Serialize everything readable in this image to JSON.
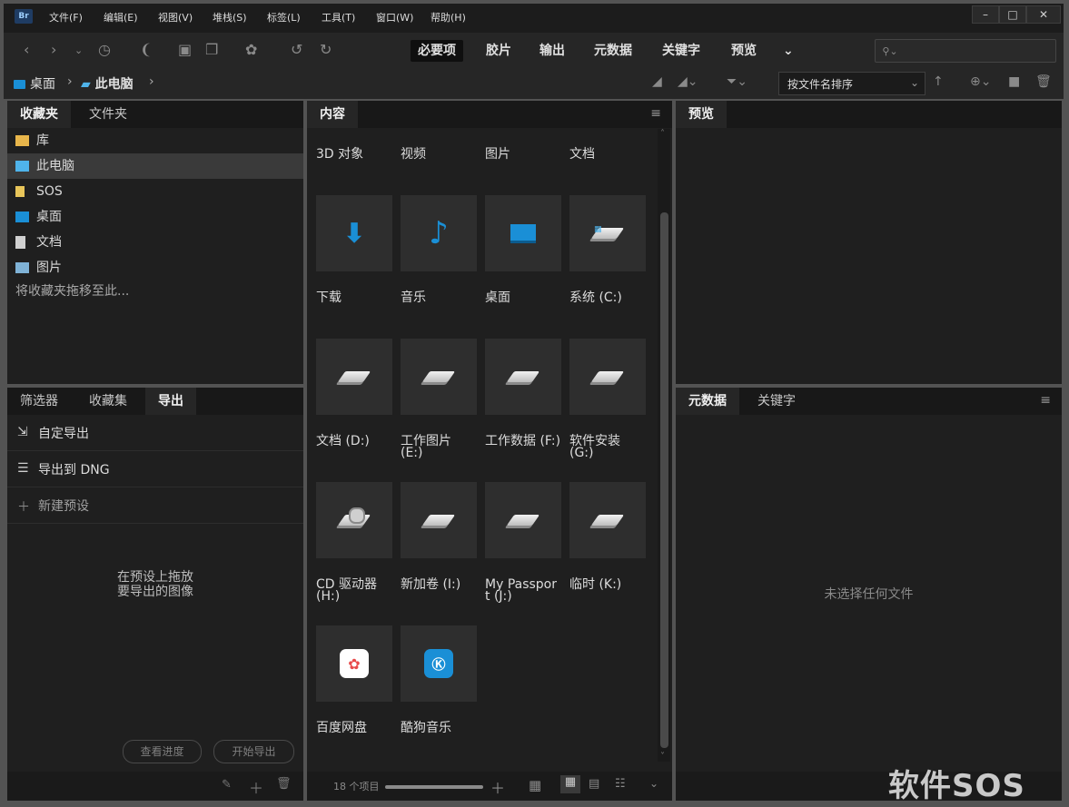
{
  "app": {
    "icon_label": "Br",
    "menus": [
      "文件(F)",
      "编辑(E)",
      "视图(V)",
      "堆栈(S)",
      "标签(L)",
      "工具(T)",
      "窗口(W)",
      "帮助(H)"
    ],
    "window_buttons": [
      "–",
      "□",
      "✕"
    ]
  },
  "toolbar": {
    "workspaces": [
      "必要项",
      "胶片",
      "输出",
      "元数据",
      "关键字",
      "预览"
    ],
    "active_workspace": "必要项",
    "more_glyph": "⌄",
    "search_placeholder": ""
  },
  "path": {
    "crumbs": [
      "桌面",
      "此电脑"
    ],
    "sort_label": "按文件名排序"
  },
  "favorites": {
    "tabs": [
      "收藏夹",
      "文件夹"
    ],
    "active_tab": "收藏夹",
    "items": [
      {
        "label": "库",
        "icon": "library-icon",
        "color": "#e8b64b"
      },
      {
        "label": "此电脑",
        "icon": "computer-icon",
        "color": "#4fb3ea"
      },
      {
        "label": "SOS",
        "icon": "folder-icon",
        "color": "#e8c55a"
      },
      {
        "label": "桌面",
        "icon": "desktop-icon",
        "color": "#1a8fd6"
      },
      {
        "label": "文档",
        "icon": "document-icon",
        "color": "#d0d0d0"
      },
      {
        "label": "图片",
        "icon": "picture-icon",
        "color": "#7fb2d6"
      }
    ],
    "selected_index": 1,
    "hint": "将收藏夹拖移至此..."
  },
  "export": {
    "tabs": [
      "筛选器",
      "收藏集",
      "导出"
    ],
    "active_tab": "导出",
    "rows": [
      {
        "label": "自定导出",
        "icon": "custom-export-icon"
      },
      {
        "label": "导出到 DNG",
        "icon": "list-icon"
      },
      {
        "label": "新建预设",
        "icon": "plus-icon"
      }
    ],
    "drop_hint_line1": "在预设上拖放",
    "drop_hint_line2": "要导出的图像",
    "progress_button": "查看进度",
    "start_button": "开始导出"
  },
  "content": {
    "tab": "内容",
    "top_labels": [
      "3D 对象",
      "视频",
      "图片",
      "文档"
    ],
    "items": [
      {
        "label": "下载",
        "icon": "download-arrow-icon"
      },
      {
        "label": "音乐",
        "icon": "music-note-icon"
      },
      {
        "label": "桌面",
        "icon": "desktop-icon"
      },
      {
        "label": "系统 (C:)",
        "icon": "windows-drive-icon"
      },
      {
        "label": "文档 (D:)",
        "icon": "drive-icon"
      },
      {
        "label": "工作图片 (E:)",
        "icon": "drive-icon"
      },
      {
        "label": "工作数据 (F:)",
        "icon": "drive-icon"
      },
      {
        "label": "软件安装 (G:)",
        "icon": "drive-icon"
      },
      {
        "label": "CD 驱动器 (H:)",
        "icon": "cd-drive-icon"
      },
      {
        "label": "新加卷 (I:)",
        "icon": "drive-icon"
      },
      {
        "label": "My Passport (J:)",
        "icon": "drive-icon"
      },
      {
        "label": "临时 (K:)",
        "icon": "drive-icon"
      },
      {
        "label": "百度网盘",
        "icon": "baidu-netdisk-icon"
      },
      {
        "label": "酷狗音乐",
        "icon": "kugou-icon"
      }
    ],
    "count_label": "18 个项目"
  },
  "preview": {
    "tab": "预览"
  },
  "metadata": {
    "tabs": [
      "元数据",
      "关键字"
    ],
    "active_tab": "元数据",
    "empty_text": "未选择任何文件"
  },
  "watermark": "软件SOS",
  "colors": {
    "accent_blue": "#1a8fd6",
    "panel_bg": "#1f1f1f",
    "selection": "#3a3a3a"
  }
}
